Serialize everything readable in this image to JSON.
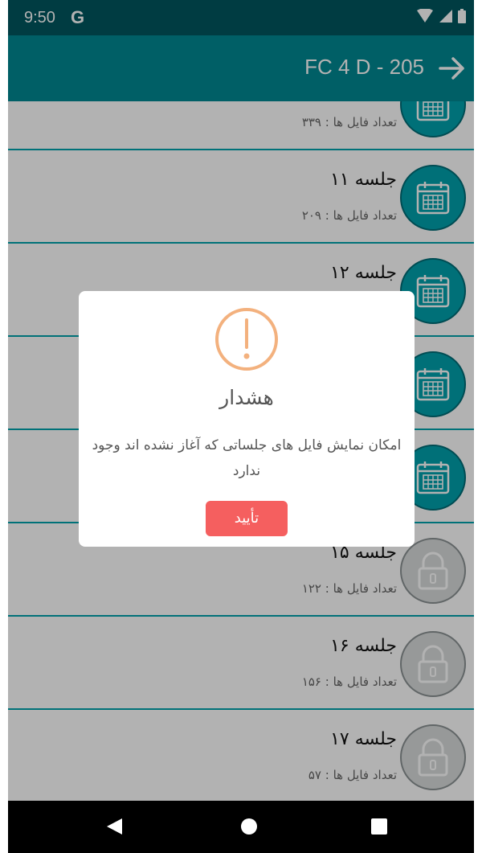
{
  "status_bar": {
    "time": "9:50",
    "g_label": "G"
  },
  "app_bar": {
    "title": "FC 4 D - 205",
    "back_icon": "arrow-right-icon"
  },
  "sessions": [
    {
      "title": "",
      "count_text": "تعداد فایل ها : ۳۳۹",
      "icon": "calendar-icon",
      "state": "available"
    },
    {
      "title": "جلسه ۱۱",
      "count_text": "تعداد فایل ها : ۲۰۹",
      "icon": "calendar-icon",
      "state": "available"
    },
    {
      "title": "جلسه ۱۲",
      "count_text": "",
      "icon": "calendar-icon",
      "state": "available"
    },
    {
      "title": "",
      "count_text": "",
      "icon": "calendar-icon",
      "state": "available"
    },
    {
      "title": "",
      "count_text": "",
      "icon": "calendar-icon",
      "state": "available"
    },
    {
      "title": "جلسه ۱۵",
      "count_text": "تعداد فایل ها : ۱۲۲",
      "icon": "lock-icon",
      "state": "locked"
    },
    {
      "title": "جلسه ۱۶",
      "count_text": "تعداد فایل ها : ۱۵۶",
      "icon": "lock-icon",
      "state": "locked"
    },
    {
      "title": "جلسه ۱۷",
      "count_text": "تعداد فایل ها : ۵۷",
      "icon": "lock-icon",
      "state": "locked"
    }
  ],
  "dialog": {
    "icon": "warning-icon",
    "title": "هشدار",
    "message": "امکان نمایش فایل های جلساتی که آغاز نشده اند وجود ندارد",
    "confirm_label": "تأیید"
  },
  "colors": {
    "primary": "#008893",
    "status_bar": "#00575f",
    "calendar": "#00a1ad",
    "warning": "#f3b17e",
    "confirm": "#f55f5f"
  }
}
